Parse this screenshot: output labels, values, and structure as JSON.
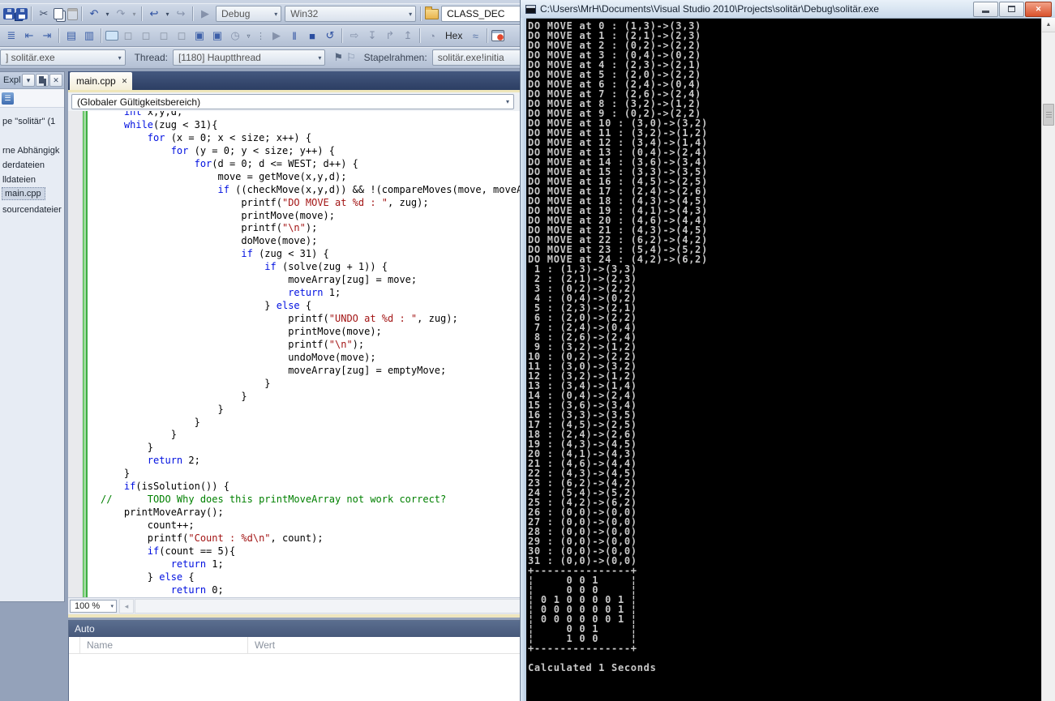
{
  "accents": {
    "keyword": "#0010e0",
    "string": "#a31515",
    "comment": "#008000",
    "console_fg": "#c8c8c8",
    "close_button": "#d9522c",
    "change_bar_green": "#3fae44",
    "tab_well": "#2c3e63",
    "vs_chrome": "#b3c0d4"
  },
  "vs": {
    "toolbars": {
      "row1_left": [
        {
          "name": "save-icon",
          "cls": "i-floppy"
        },
        {
          "name": "save-all-icon",
          "cls": "i-floppy i-floppy2"
        },
        {
          "type": "sep",
          "name": "toolbar-separator"
        },
        {
          "name": "cut-icon",
          "glyph": "✂",
          "color": "#41506a"
        },
        {
          "name": "copy-icon",
          "cls": "i-copy"
        },
        {
          "name": "paste-icon",
          "cls": "i-paste",
          "dim": true
        },
        {
          "type": "sep",
          "name": "toolbar-separator"
        },
        {
          "name": "undo-icon",
          "glyph": "↶",
          "color": "#2b4ea0"
        },
        {
          "name": "undo-dropdown",
          "cls": "i-dd",
          "glyph": "▾"
        },
        {
          "name": "redo-icon",
          "glyph": "↷",
          "dim": true
        },
        {
          "name": "redo-dropdown",
          "cls": "i-dd",
          "glyph": "▾",
          "dim": true
        },
        {
          "type": "sep",
          "name": "toolbar-separator"
        },
        {
          "name": "navigate-back-icon",
          "glyph": "↩",
          "color": "#2b4ea0"
        },
        {
          "name": "navigate-back-dropdown",
          "cls": "i-dd",
          "glyph": "▾"
        },
        {
          "name": "navigate-forward-icon",
          "glyph": "↪",
          "dim": true
        },
        {
          "type": "sep",
          "name": "toolbar-separator"
        },
        {
          "name": "start-debug-icon",
          "glyph": "▶",
          "dim": true
        }
      ],
      "row1_right": [
        {
          "type": "sep",
          "name": "toolbar-separator"
        },
        {
          "name": "find-in-files-icon",
          "cls": "i-folder"
        }
      ],
      "row2": [
        {
          "name": "outlining-icon",
          "glyph": "≣",
          "color": "#3c5fa8"
        },
        {
          "name": "indent-decrease-icon",
          "glyph": "⇤",
          "color": "#3c5fa8"
        },
        {
          "name": "indent-increase-icon",
          "glyph": "⇥",
          "color": "#3c5fa8"
        },
        {
          "type": "sep",
          "name": "toolbar-separator"
        },
        {
          "name": "comment-icon",
          "glyph": "▤",
          "color": "#3c5fa8"
        },
        {
          "name": "uncomment-icon",
          "glyph": "▥",
          "color": "#3c5fa8"
        },
        {
          "type": "sep",
          "name": "toolbar-separator"
        },
        {
          "name": "message-box-icon",
          "cls": "i-msgbox"
        },
        {
          "name": "bookmark-prev-icon",
          "glyph": "◻",
          "color": "#8a94a4"
        },
        {
          "name": "bookmark-next-icon",
          "glyph": "◻",
          "color": "#8a94a4"
        },
        {
          "name": "bookmark-folder-icon",
          "glyph": "◻",
          "color": "#8a94a4"
        },
        {
          "name": "bookmark-clear-icon",
          "glyph": "◻",
          "color": "#8a94a4"
        },
        {
          "name": "bubble-back-icon",
          "glyph": "▣",
          "color": "#3c5fa8"
        },
        {
          "name": "bubble-forward-icon",
          "glyph": "▣",
          "color": "#3c5fa8"
        },
        {
          "name": "find-symbol-icon",
          "glyph": "◷",
          "dim": true
        },
        {
          "name": "toolbar-overflow-dropdown",
          "cls": "i-dd",
          "glyph": "▿"
        },
        {
          "type": "dots",
          "name": "toolbar-handle"
        },
        {
          "name": "continue-icon",
          "glyph": "▶",
          "dim": true
        },
        {
          "name": "break-all-icon",
          "glyph": "‖",
          "color": "#2b4ea0"
        },
        {
          "name": "stop-debugging-icon",
          "glyph": "■",
          "color": "#2b4ea0"
        },
        {
          "name": "restart-icon",
          "glyph": "↺",
          "color": "#2b4ea0"
        },
        {
          "type": "sep",
          "name": "toolbar-separator"
        },
        {
          "name": "show-next-statement-icon",
          "glyph": "⇨",
          "dim": true
        },
        {
          "name": "step-into-icon",
          "glyph": "↧",
          "dim": true
        },
        {
          "name": "step-over-icon",
          "glyph": "↱",
          "dim": true
        },
        {
          "name": "step-out-icon",
          "glyph": "↥",
          "dim": true
        },
        {
          "type": "sep",
          "name": "toolbar-separator"
        },
        {
          "name": "breakpoints-window-icon",
          "glyph": "◔",
          "dim": true
        },
        {
          "type": "text",
          "name": "hex-toggle-button",
          "label": "Hex"
        },
        {
          "name": "exceptions-icon",
          "glyph": "≈",
          "color": "#5b76a8"
        },
        {
          "type": "sep",
          "name": "toolbar-separator"
        },
        {
          "name": "immediate-window-icon",
          "cls": "i-redwin"
        }
      ]
    },
    "combos": {
      "debug": "Debug",
      "platform": "Win32",
      "search": "CLASS_DEC",
      "process": "] solitär.exe",
      "thread": "[1180] Hauptthread",
      "stack": "solitär.exe!initia"
    },
    "labels": {
      "thread": "Thread:",
      "stack": "Stapelrahmen:"
    },
    "solution_explorer": {
      "title": "Expl...",
      "items": [
        {
          "label": "pe \"solitär\" (1"
        },
        {
          "label": "",
          "blank": true
        },
        {
          "label": "rne Abhängigk"
        },
        {
          "label": "derdateien"
        },
        {
          "label": "lldateien"
        },
        {
          "label": "main.cpp",
          "selected": true
        },
        {
          "label": "sourcendateier"
        }
      ]
    },
    "editor": {
      "tab_label": "main.cpp",
      "tab_close": "✕",
      "nav_combo": "(Globaler Gültigkeitsbereich)",
      "zoom_label": "100 %",
      "code_lines": [
        [
          [
            "p",
            "    "
          ],
          [
            "k",
            "int"
          ],
          [
            "p",
            " x,y,d;"
          ]
        ],
        [
          [
            "p",
            "    "
          ],
          [
            "k",
            "while"
          ],
          [
            "p",
            "(zug < 31){"
          ]
        ],
        [
          [
            "p",
            "        "
          ],
          [
            "k",
            "for"
          ],
          [
            "p",
            " (x = 0; x < size; x++) {"
          ]
        ],
        [
          [
            "p",
            "            "
          ],
          [
            "k",
            "for"
          ],
          [
            "p",
            " (y = 0; y < size; y++) {"
          ]
        ],
        [
          [
            "p",
            "                "
          ],
          [
            "k",
            "for"
          ],
          [
            "p",
            "(d = 0; d <= WEST; d++) {"
          ]
        ],
        [
          [
            "p",
            "                    move = getMove(x,y,d);"
          ]
        ],
        [
          [
            "p",
            "                    "
          ],
          [
            "k",
            "if"
          ],
          [
            "p",
            " ((checkMove(x,y,d)) && !(compareMoves(move, moveArr"
          ]
        ],
        [
          [
            "p",
            "                        printf("
          ],
          [
            "s",
            "\"DO MOVE at %d : \""
          ],
          [
            "p",
            ", zug);"
          ]
        ],
        [
          [
            "p",
            "                        printMove(move);"
          ]
        ],
        [
          [
            "p",
            "                        printf("
          ],
          [
            "s",
            "\"\\n\""
          ],
          [
            "p",
            ");"
          ]
        ],
        [
          [
            "p",
            "                        doMove(move);"
          ]
        ],
        [
          [
            "p",
            "                        "
          ],
          [
            "k",
            "if"
          ],
          [
            "p",
            " (zug < 31) {"
          ]
        ],
        [
          [
            "p",
            "                            "
          ],
          [
            "k",
            "if"
          ],
          [
            "p",
            " (solve(zug + 1)) {"
          ]
        ],
        [
          [
            "p",
            "                                moveArray[zug] = move;"
          ]
        ],
        [
          [
            "p",
            "                                "
          ],
          [
            "k",
            "return"
          ],
          [
            "p",
            " 1;"
          ]
        ],
        [
          [
            "p",
            "                            } "
          ],
          [
            "k",
            "else"
          ],
          [
            "p",
            " {"
          ]
        ],
        [
          [
            "p",
            "                                printf("
          ],
          [
            "s",
            "\"UNDO at %d : \""
          ],
          [
            "p",
            ", zug);"
          ]
        ],
        [
          [
            "p",
            "                                printMove(move);"
          ]
        ],
        [
          [
            "p",
            "                                printf("
          ],
          [
            "s",
            "\"\\n\""
          ],
          [
            "p",
            ");"
          ]
        ],
        [
          [
            "p",
            "                                undoMove(move);"
          ]
        ],
        [
          [
            "p",
            "                                moveArray[zug] = emptyMove;"
          ]
        ],
        [
          [
            "p",
            "                            }"
          ]
        ],
        [
          [
            "p",
            "                        }"
          ]
        ],
        [
          [
            "p",
            "                    }"
          ]
        ],
        [
          [
            "p",
            "                }"
          ]
        ],
        [
          [
            "p",
            "            }"
          ]
        ],
        [
          [
            "p",
            "        }"
          ]
        ],
        [
          [
            "p",
            "        "
          ],
          [
            "k",
            "return"
          ],
          [
            "p",
            " 2;"
          ]
        ],
        [
          [
            "p",
            "    }"
          ]
        ],
        [
          [
            "p",
            "    "
          ],
          [
            "k",
            "if"
          ],
          [
            "p",
            "(isSolution()) {"
          ]
        ],
        [
          [
            "c",
            "//      TODO Why does this printMoveArray not work correct?"
          ]
        ],
        [
          [
            "p",
            "    printMoveArray();"
          ]
        ],
        [
          [
            "p",
            "        count++;"
          ]
        ],
        [
          [
            "p",
            "        printf("
          ],
          [
            "s",
            "\"Count : %d\\n\""
          ],
          [
            "p",
            ", count);"
          ]
        ],
        [
          [
            "p",
            "        "
          ],
          [
            "k",
            "if"
          ],
          [
            "p",
            "(count == 5){"
          ]
        ],
        [
          [
            "p",
            "            "
          ],
          [
            "k",
            "return"
          ],
          [
            "p",
            " 1;"
          ]
        ],
        [
          [
            "p",
            "        } "
          ],
          [
            "k",
            "else"
          ],
          [
            "p",
            " {"
          ]
        ],
        [
          [
            "p",
            "            "
          ],
          [
            "k",
            "return"
          ],
          [
            "p",
            " 0;"
          ]
        ]
      ]
    },
    "auto_window": {
      "title": "Auto",
      "col_name": "Name",
      "col_wert": "Wert"
    }
  },
  "console": {
    "title": "C:\\Users\\MrH\\Documents\\Visual Studio 2010\\Projects\\solitär\\Debug\\solitär.exe",
    "lines": [
      "DO MOVE at 0 : (1,3)->(3,3)",
      "DO MOVE at 1 : (2,1)->(2,3)",
      "DO MOVE at 2 : (0,2)->(2,2)",
      "DO MOVE at 3 : (0,4)->(0,2)",
      "DO MOVE at 4 : (2,3)->(2,1)",
      "DO MOVE at 5 : (2,0)->(2,2)",
      "DO MOVE at 6 : (2,4)->(0,4)",
      "DO MOVE at 7 : (2,6)->(2,4)",
      "DO MOVE at 8 : (3,2)->(1,2)",
      "DO MOVE at 9 : (0,2)->(2,2)",
      "DO MOVE at 10 : (3,0)->(3,2)",
      "DO MOVE at 11 : (3,2)->(1,2)",
      "DO MOVE at 12 : (3,4)->(1,4)",
      "DO MOVE at 13 : (0,4)->(2,4)",
      "DO MOVE at 14 : (3,6)->(3,4)",
      "DO MOVE at 15 : (3,3)->(3,5)",
      "DO MOVE at 16 : (4,5)->(2,5)",
      "DO MOVE at 17 : (2,4)->(2,6)",
      "DO MOVE at 18 : (4,3)->(4,5)",
      "DO MOVE at 19 : (4,1)->(4,3)",
      "DO MOVE at 20 : (4,6)->(4,4)",
      "DO MOVE at 21 : (4,3)->(4,5)",
      "DO MOVE at 22 : (6,2)->(4,2)",
      "DO MOVE at 23 : (5,4)->(5,2)",
      "DO MOVE at 24 : (4,2)->(6,2)",
      " 1 : (1,3)->(3,3)",
      " 2 : (2,1)->(2,3)",
      " 3 : (0,2)->(2,2)",
      " 4 : (0,4)->(0,2)",
      " 5 : (2,3)->(2,1)",
      " 6 : (2,0)->(2,2)",
      " 7 : (2,4)->(0,4)",
      " 8 : (2,6)->(2,4)",
      " 9 : (3,2)->(1,2)",
      "10 : (0,2)->(2,2)",
      "11 : (3,0)->(3,2)",
      "12 : (3,2)->(1,2)",
      "13 : (3,4)->(1,4)",
      "14 : (0,4)->(2,4)",
      "15 : (3,6)->(3,4)",
      "16 : (3,3)->(3,5)",
      "17 : (4,5)->(2,5)",
      "18 : (2,4)->(2,6)",
      "19 : (4,3)->(4,5)",
      "20 : (4,1)->(4,3)",
      "21 : (4,6)->(4,4)",
      "22 : (4,3)->(4,5)",
      "23 : (6,2)->(4,2)",
      "24 : (5,4)->(5,2)",
      "25 : (4,2)->(6,2)",
      "26 : (0,0)->(0,0)",
      "27 : (0,0)->(0,0)",
      "28 : (0,0)->(0,0)",
      "29 : (0,0)->(0,0)",
      "30 : (0,0)->(0,0)",
      "31 : (0,0)->(0,0)",
      "+---------------+",
      "¦     0 0 1     ¦",
      "¦     0 0 0     ¦",
      "¦ 0 1 0 0 0 0 1 ¦",
      "¦ 0 0 0 0 0 0 1 ¦",
      "¦ 0 0 0 0 0 0 1 ¦",
      "¦     0 0 1     ¦",
      "¦     1 0 0     ¦",
      "+---------------+",
      "",
      "Calculated 1 Seconds"
    ]
  }
}
